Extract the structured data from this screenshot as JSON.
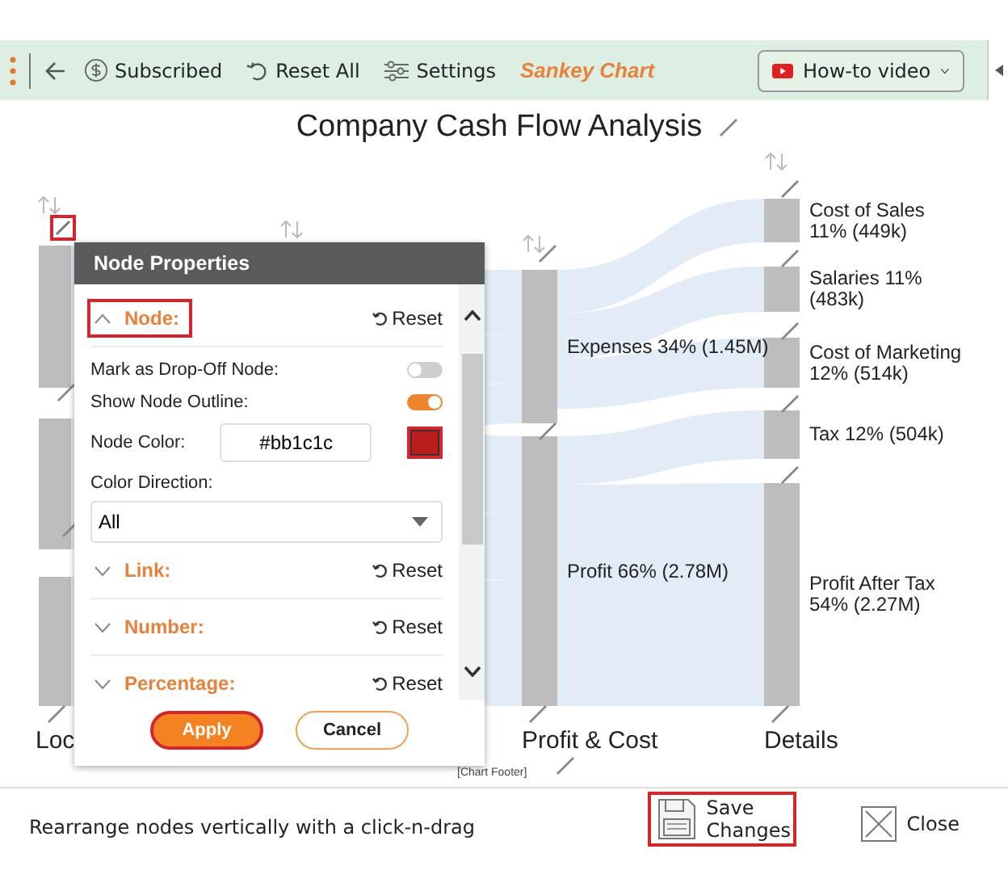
{
  "toolbar": {
    "items": [
      {
        "kind": "subscribed",
        "label": "Subscribed"
      },
      {
        "kind": "reset",
        "label": "Reset All"
      },
      {
        "kind": "settings",
        "label": "Settings"
      }
    ],
    "app_name": "Sankey Chart",
    "video_button": {
      "label": "How-to video"
    }
  },
  "chart": {
    "title": "Company Cash Flow Analysis",
    "footer": "[Chart Footer]",
    "columns": [
      {
        "label": "Loc",
        "edit_highlighted": true
      },
      {
        "label": "Profit & Cost",
        "nodes": [
          {
            "label": "Expenses 34% (1.45M)"
          },
          {
            "label": "Profit 66% (2.78M)"
          }
        ]
      },
      {
        "label": "Details",
        "nodes": [
          {
            "label": "Cost of Sales 11% (449k)"
          },
          {
            "label": "Salaries 11% (483k)"
          },
          {
            "label": "Cost of Marketing 12% (514k)"
          },
          {
            "label": "Tax 12% (504k)"
          },
          {
            "label": "Profit After Tax 54% (2.27M)"
          }
        ]
      }
    ]
  },
  "dialog": {
    "title": "Node Properties",
    "sections": [
      {
        "label": "Node:",
        "reset": "Reset",
        "expanded": true,
        "highlighted": true
      },
      {
        "label": "Link:",
        "reset": "Reset",
        "expanded": false,
        "highlighted": false
      },
      {
        "label": "Number:",
        "reset": "Reset",
        "expanded": false,
        "highlighted": false
      },
      {
        "label": "Percentage:",
        "reset": "Reset",
        "expanded": false,
        "highlighted": false
      }
    ],
    "fields": [
      {
        "kind": "toggle",
        "label": "Mark as Drop-Off Node:",
        "on": false
      },
      {
        "kind": "toggle",
        "label": "Show Node Outline:",
        "on": true
      },
      {
        "kind": "color",
        "label": "Node Color:",
        "value": "#bb1c1c",
        "color": "#bb1c1c",
        "highlighted": true
      },
      {
        "kind": "select",
        "label": "Color Direction:",
        "value": "All"
      }
    ],
    "buttons": [
      {
        "kind": "primary",
        "label": "Apply",
        "highlighted": true
      },
      {
        "kind": "secondary",
        "label": "Cancel",
        "highlighted": false
      }
    ]
  },
  "footer": {
    "hint": "Rearrange nodes vertically with a click-n-drag",
    "buttons": [
      {
        "kind": "save",
        "label": "Save Changes",
        "highlighted": true
      },
      {
        "kind": "close",
        "label": "Close",
        "highlighted": false
      }
    ]
  }
}
